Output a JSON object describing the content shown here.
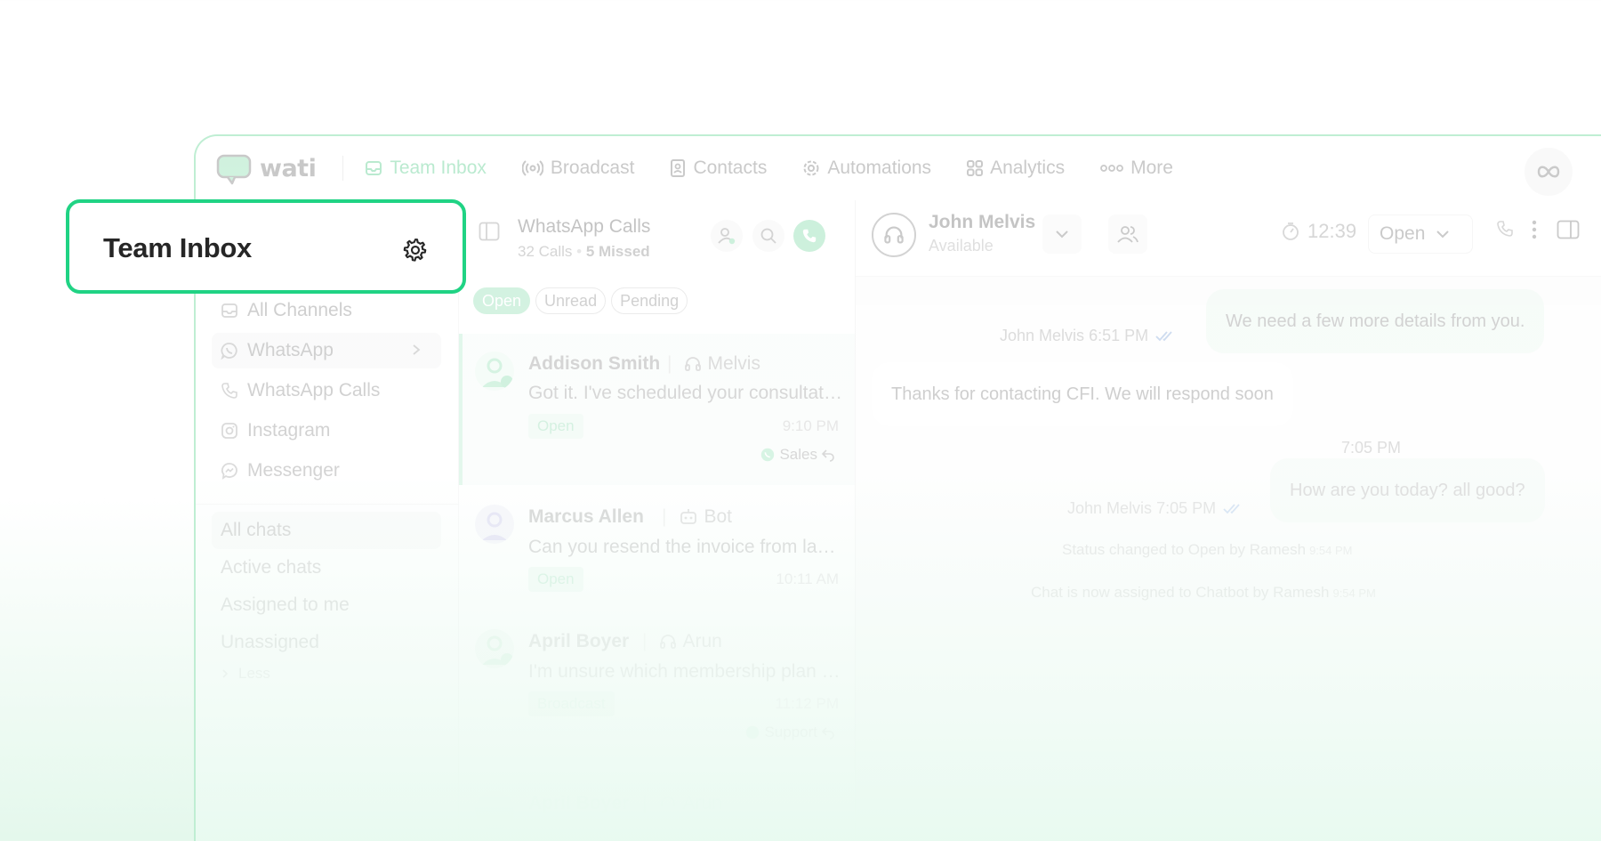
{
  "brand": {
    "logo_text": "wati",
    "accent": "#20d384"
  },
  "nav": {
    "items": [
      {
        "label": "Team Inbox",
        "icon": "inbox-icon",
        "active": true
      },
      {
        "label": "Broadcast",
        "icon": "broadcast-icon"
      },
      {
        "label": "Contacts",
        "icon": "contacts-icon"
      },
      {
        "label": "Automations",
        "icon": "gear-icon"
      },
      {
        "label": "Analytics",
        "icon": "grid-icon"
      },
      {
        "label": "More",
        "icon": "more-dots-icon"
      }
    ],
    "meta_icon": "meta-infinity-icon"
  },
  "callout": {
    "title": "Team Inbox",
    "icon": "settings-gear-icon"
  },
  "sidebar": {
    "channels": [
      {
        "label": "All Channels",
        "icon": "inbox-icon"
      },
      {
        "label": "WhatsApp",
        "icon": "whatsapp-icon",
        "active": true
      },
      {
        "label": "WhatsApp Calls",
        "icon": "phone-icon"
      },
      {
        "label": "Instagram",
        "icon": "instagram-icon"
      },
      {
        "label": "Messenger",
        "icon": "messenger-icon"
      }
    ],
    "filters": [
      {
        "label": "All chats",
        "active": true
      },
      {
        "label": "Active chats"
      },
      {
        "label": "Assigned to me"
      },
      {
        "label": "Unassigned"
      }
    ],
    "less_label": "Less"
  },
  "conversations": {
    "title": "WhatsApp Calls",
    "calls": "32 Calls",
    "missed": "5 Missed",
    "tabs": [
      "Open",
      "Unread",
      "Pending"
    ],
    "items": [
      {
        "name": "Addison Smith",
        "agent": "Melvis",
        "message": "Got it. I've scheduled your consultation for tomorrow",
        "status": "Open",
        "time": "9:10 PM",
        "team": "Sales"
      },
      {
        "name": "Marcus Allen",
        "agent": "Bot",
        "message": "Can you resend the invoice from last month please",
        "status": "Open",
        "time": "10:11 AM"
      },
      {
        "name": "April Boyer",
        "agent": "Arun",
        "message": "I'm unsure which membership plan suits me best",
        "status": "Broadcast",
        "time": "11:12 PM",
        "team": "Support"
      },
      {
        "name": "April Boyer",
        "agent": "Arun"
      }
    ]
  },
  "chat": {
    "contact_name": "John Melvis",
    "contact_status": "Available",
    "timer": "12:39",
    "status_select": "Open",
    "messages": [
      {
        "text": "We need a few more details from you.",
        "sender": "John Melvis",
        "time": "6:51 PM",
        "direction": "out"
      },
      {
        "text": "Thanks for contacting CFI. We will respond soon",
        "time": "7:05 PM",
        "direction": "in"
      },
      {
        "text": "How are you today? all good?",
        "sender": "John Melvis",
        "time": "7:05 PM",
        "direction": "out"
      }
    ],
    "system": [
      {
        "text": "Status changed to Open by Ramesh",
        "time": "9:54 PM"
      },
      {
        "text": "Chat is now assigned to Chatbot by Ramesh",
        "time": "9:54 PM"
      }
    ]
  }
}
